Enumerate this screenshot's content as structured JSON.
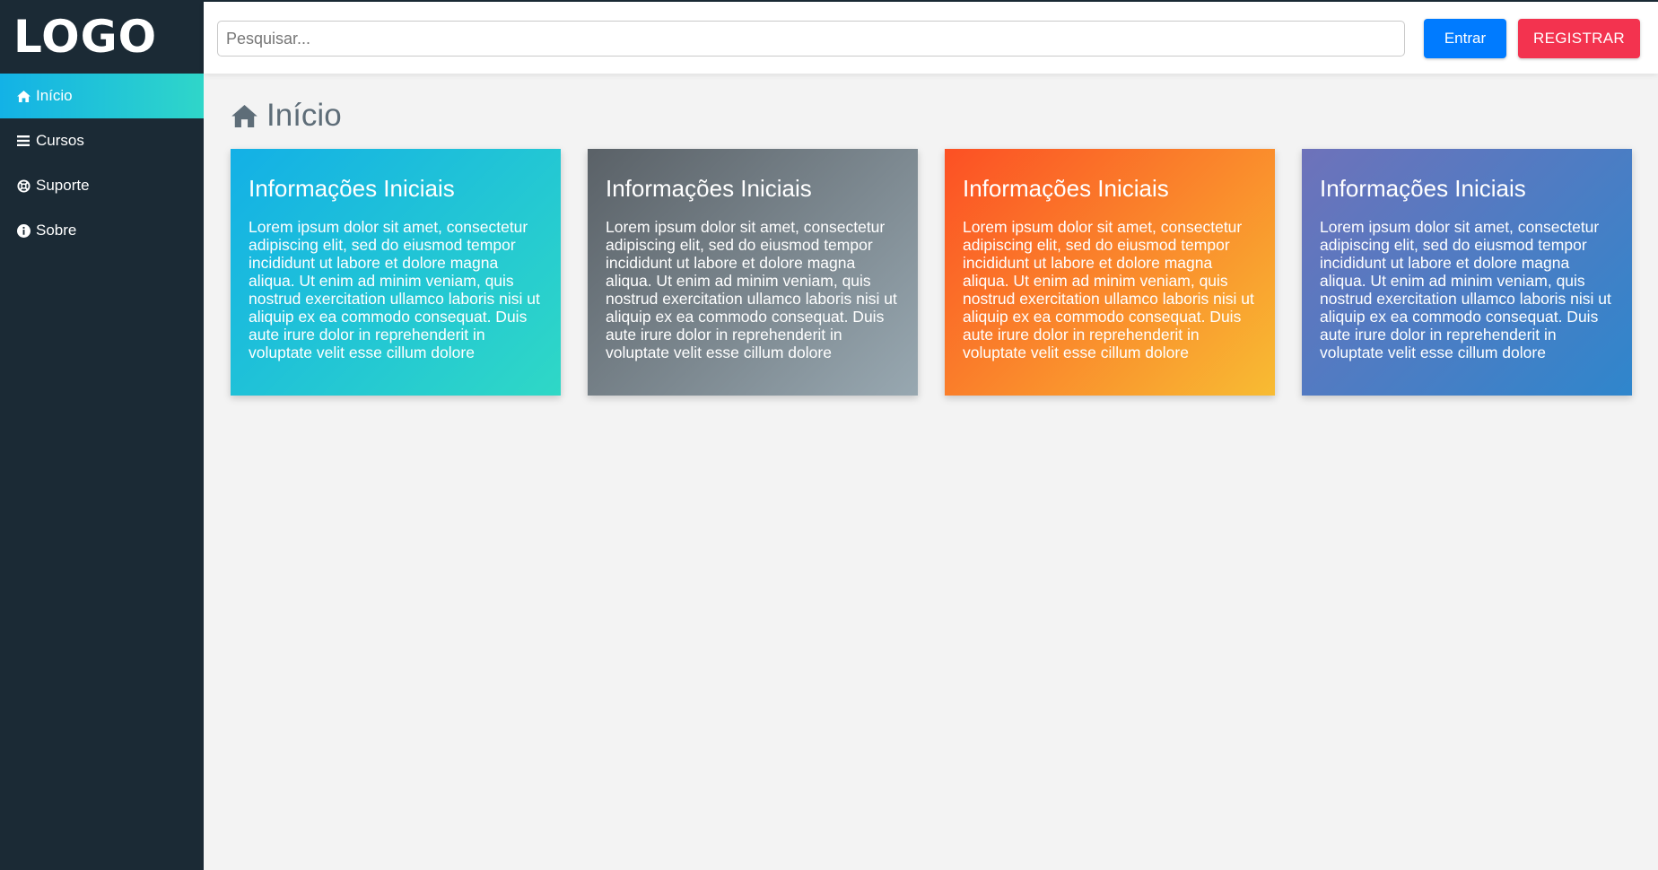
{
  "sidebar": {
    "logo": "LOGO",
    "items": [
      {
        "label": "Início",
        "icon": "home-icon",
        "active": true
      },
      {
        "label": "Cursos",
        "icon": "bars-icon",
        "active": false
      },
      {
        "label": "Suporte",
        "icon": "life-ring-icon",
        "active": false
      },
      {
        "label": "Sobre",
        "icon": "info-circle-icon",
        "active": false
      }
    ]
  },
  "header": {
    "search_placeholder": "Pesquisar...",
    "search_value": "",
    "login_label": "Entrar",
    "register_label": "REGISTRAR"
  },
  "main": {
    "title": "Início",
    "title_icon": "home-icon",
    "cards": [
      {
        "title": "Informações Iniciais",
        "body": "Lorem ipsum dolor sit amet, consectetur adipiscing elit, sed do eiusmod tempor incididunt ut labore et dolore magna aliqua. Ut enim ad minim veniam, quis nostrud exercitation ullamco laboris nisi ut aliquip ex ea commodo consequat. Duis aute irure dolor in reprehenderit in voluptate velit esse cillum dolore"
      },
      {
        "title": "Informações Iniciais",
        "body": "Lorem ipsum dolor sit amet, consectetur adipiscing elit, sed do eiusmod tempor incididunt ut labore et dolore magna aliqua. Ut enim ad minim veniam, quis nostrud exercitation ullamco laboris nisi ut aliquip ex ea commodo consequat. Duis aute irure dolor in reprehenderit in voluptate velit esse cillum dolore"
      },
      {
        "title": "Informações Iniciais",
        "body": "Lorem ipsum dolor sit amet, consectetur adipiscing elit, sed do eiusmod tempor incididunt ut labore et dolore magna aliqua. Ut enim ad minim veniam, quis nostrud exercitation ullamco laboris nisi ut aliquip ex ea commodo consequat. Duis aute irure dolor in reprehenderit in voluptate velit esse cillum dolore"
      },
      {
        "title": "Informações Iniciais",
        "body": "Lorem ipsum dolor sit amet, consectetur adipiscing elit, sed do eiusmod tempor incididunt ut labore et dolore magna aliqua. Ut enim ad minim veniam, quis nostrud exercitation ullamco laboris nisi ut aliquip ex ea commodo consequat. Duis aute irure dolor in reprehenderit in voluptate velit esse cillum dolore"
      }
    ]
  },
  "colors": {
    "sidebar_bg": "#1b2a35",
    "active_item": "#13b2e6",
    "login_button": "#007bff",
    "register_button": "#f3334f",
    "page_bg": "#f3f3f3"
  }
}
